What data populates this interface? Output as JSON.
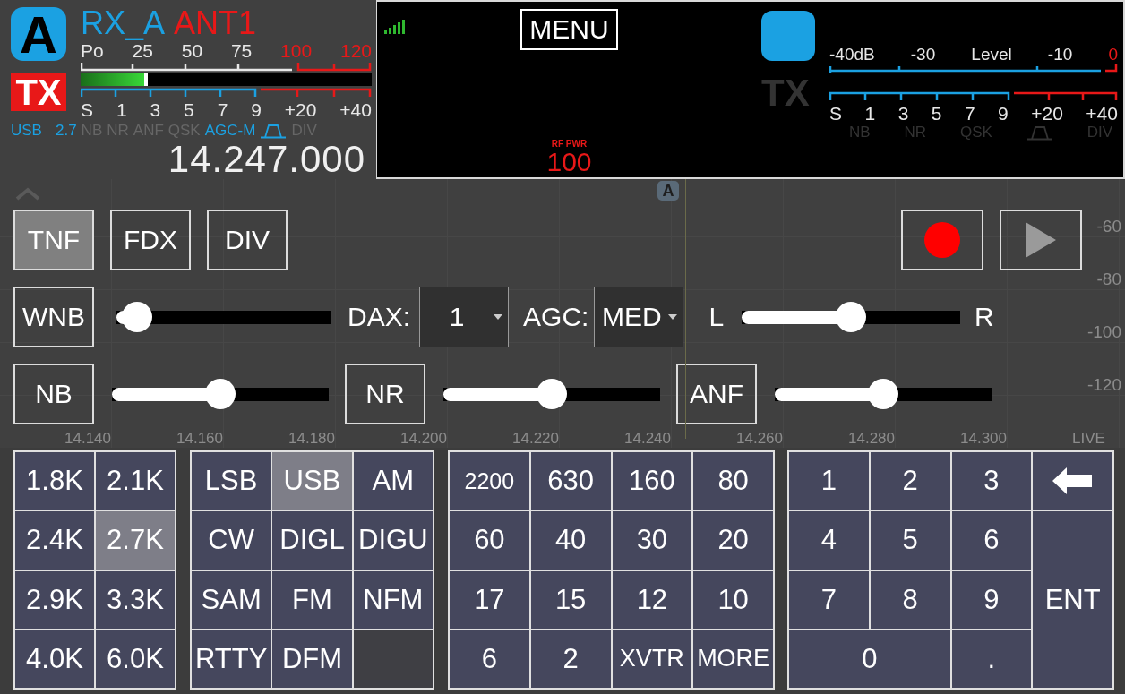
{
  "slice": {
    "letter": "A",
    "receiver": "RX_A",
    "antenna": "ANT1",
    "tx": {
      "label": "TX",
      "on": true
    },
    "power_scale": [
      {
        "label": "Po",
        "over_range": false
      },
      {
        "label": "25",
        "over_range": false
      },
      {
        "label": "50",
        "over_range": false
      },
      {
        "label": "75",
        "over_range": false
      },
      {
        "label": "100",
        "over_range": true
      },
      {
        "label": "120",
        "over_range": true
      }
    ],
    "power_meter": {
      "level": 0.23
    },
    "s_scale": [
      "S",
      "1",
      "3",
      "5",
      "7",
      "9",
      "+20",
      "+40"
    ],
    "indicators": [
      {
        "kind": "text",
        "label": "USB",
        "on": true
      },
      {
        "kind": "text",
        "label": "2.7",
        "on": true
      },
      {
        "kind": "text",
        "label": "NB",
        "on": false
      },
      {
        "kind": "text",
        "label": "NR",
        "on": false
      },
      {
        "kind": "text",
        "label": "ANF",
        "on": false
      },
      {
        "kind": "text",
        "label": "QSK",
        "on": false
      },
      {
        "kind": "text",
        "label": "AGC-M",
        "on": true
      },
      {
        "kind": "filter",
        "on": true
      },
      {
        "kind": "text",
        "label": "DIV",
        "on": false
      }
    ],
    "frequency": "14.247.000"
  },
  "display": {
    "menu": "MENU",
    "rf_power": {
      "label": "RF PWR",
      "value": "100"
    },
    "tx": {
      "label": "TX",
      "on": false
    },
    "level_scale": [
      {
        "label": "-40dB",
        "over_range": false
      },
      {
        "label": "-30",
        "over_range": false
      },
      {
        "label": "Level",
        "over_range": false
      },
      {
        "label": "-10",
        "over_range": false
      },
      {
        "label": "0",
        "over_range": true
      }
    ],
    "s_scale": [
      "S",
      "1",
      "3",
      "5",
      "7",
      "9",
      "+20",
      "+40"
    ],
    "indicators": [
      {
        "kind": "text",
        "label": "NB",
        "on": false
      },
      {
        "kind": "text",
        "label": "NR",
        "on": false
      },
      {
        "kind": "text",
        "label": "QSK",
        "on": false
      },
      {
        "kind": "filter",
        "on": false
      },
      {
        "kind": "text",
        "label": "DIV",
        "on": false
      }
    ]
  },
  "panadapter": {
    "slice_marker": "A",
    "db_scale": [
      "-60",
      "-80",
      "-100",
      "-120"
    ],
    "freq_axis": [
      "14.140",
      "14.160",
      "14.180",
      "14.200",
      "14.220",
      "14.240",
      "14.260",
      "14.280",
      "14.300",
      "LIVE"
    ]
  },
  "controls": {
    "toggles": [
      {
        "label": "TNF",
        "selected": true
      },
      {
        "label": "FDX",
        "selected": false
      },
      {
        "label": "DIV",
        "selected": false
      }
    ],
    "wnb": {
      "label": "WNB",
      "on": false,
      "level": 0.03
    },
    "dax": {
      "label": "DAX:",
      "value": "1"
    },
    "agc": {
      "label": "AGC:",
      "value": "MED"
    },
    "pan": {
      "left": "L",
      "right": "R",
      "level": 0.5
    },
    "filters": [
      {
        "label": "NB",
        "on": false,
        "level": 0.5
      },
      {
        "label": "NR",
        "on": false,
        "level": 0.5
      },
      {
        "label": "ANF",
        "on": false,
        "level": 0.5
      }
    ]
  },
  "bandwidths": [
    {
      "label": "1.8K",
      "selected": false
    },
    {
      "label": "2.1K",
      "selected": false
    },
    {
      "label": "2.4K",
      "selected": false
    },
    {
      "label": "2.7K",
      "selected": true
    },
    {
      "label": "2.9K",
      "selected": false
    },
    {
      "label": "3.3K",
      "selected": false
    },
    {
      "label": "4.0K",
      "selected": false
    },
    {
      "label": "6.0K",
      "selected": false
    }
  ],
  "modes": [
    {
      "label": "LSB",
      "selected": false
    },
    {
      "label": "USB",
      "selected": true
    },
    {
      "label": "AM",
      "selected": false
    },
    {
      "label": "CW",
      "selected": false
    },
    {
      "label": "DIGL",
      "selected": false
    },
    {
      "label": "DIGU",
      "selected": false
    },
    {
      "label": "SAM",
      "selected": false
    },
    {
      "label": "FM",
      "selected": false
    },
    {
      "label": "NFM",
      "selected": false
    },
    {
      "label": "RTTY",
      "selected": false
    },
    {
      "label": "DFM",
      "selected": false
    }
  ],
  "bands": [
    "2200",
    "630",
    "160",
    "80",
    "60",
    "40",
    "30",
    "20",
    "17",
    "15",
    "12",
    "10",
    "6",
    "2",
    "XVTR",
    "MORE"
  ],
  "keypad": [
    {
      "kind": "digit",
      "label": "1"
    },
    {
      "kind": "digit",
      "label": "2"
    },
    {
      "kind": "digit",
      "label": "3"
    },
    {
      "kind": "backspace"
    },
    {
      "kind": "digit",
      "label": "4"
    },
    {
      "kind": "digit",
      "label": "5"
    },
    {
      "kind": "digit",
      "label": "6"
    },
    {
      "kind": "digit",
      "label": "7"
    },
    {
      "kind": "digit",
      "label": "8"
    },
    {
      "kind": "digit",
      "label": "9"
    },
    {
      "kind": "enter",
      "label": "ENT"
    },
    {
      "kind": "wide",
      "label": "0"
    },
    {
      "kind": "digit",
      "label": "."
    }
  ]
}
